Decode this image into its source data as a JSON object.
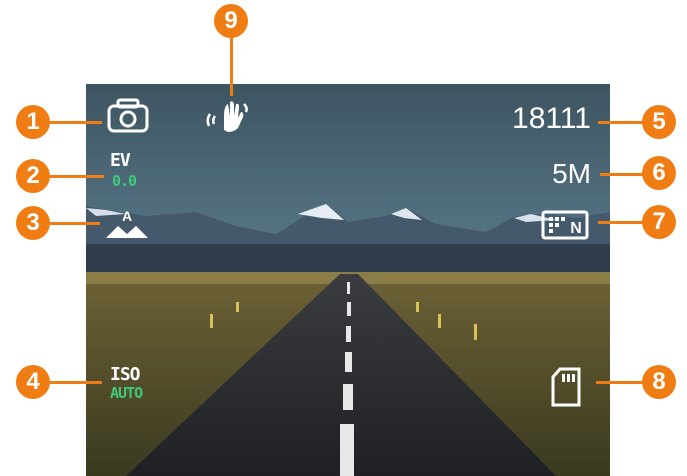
{
  "screen": {
    "shots_remaining": "18111",
    "resolution": "5M",
    "ev": {
      "label": "EV",
      "value": "0.0"
    },
    "iso": {
      "label": "ISO",
      "value": "AUTO"
    },
    "icons": {
      "mode": "camera-mode-icon",
      "white_balance": "white-balance-auto-icon",
      "stabilization": "hand-shake-icon",
      "quality": "quality-icon",
      "sd_card": "sd-card-icon"
    },
    "quality_letter": "N",
    "wb_letter": "A"
  },
  "callouts": [
    "1",
    "2",
    "3",
    "4",
    "5",
    "6",
    "7",
    "8",
    "9"
  ],
  "colors": {
    "callout": "#f07d14",
    "value_green": "#3fc97a"
  }
}
